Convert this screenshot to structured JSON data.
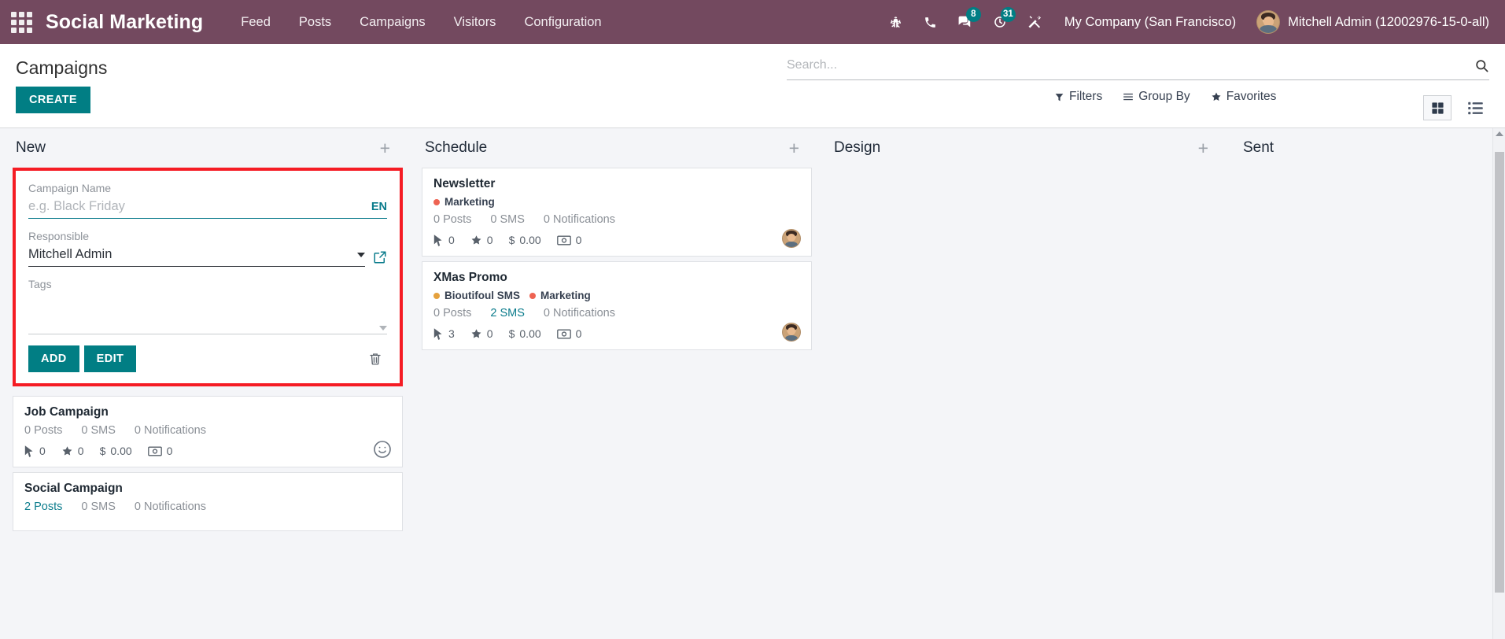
{
  "navbar": {
    "apps_icon": "apps-grid-icon",
    "brand": "Social Marketing",
    "menu": [
      {
        "label": "Feed"
      },
      {
        "label": "Posts"
      },
      {
        "label": "Campaigns"
      },
      {
        "label": "Visitors"
      },
      {
        "label": "Configuration"
      }
    ],
    "sysicons": [
      {
        "name": "bug-icon",
        "badge": null
      },
      {
        "name": "phone-icon",
        "badge": null
      },
      {
        "name": "messages-icon",
        "badge": "8"
      },
      {
        "name": "activities-clock-icon",
        "badge": "31"
      },
      {
        "name": "tools-wrench-icon",
        "badge": null
      }
    ],
    "company": "My Company (San Francisco)",
    "user": "Mitchell Admin (12002976-15-0-all)",
    "background_color": "#73495f",
    "badge_color": "#017e84"
  },
  "control_panel": {
    "title": "Campaigns",
    "create_label": "CREATE",
    "accent_color": "#017e84",
    "search": {
      "placeholder": "Search...",
      "value": "",
      "icon": "search-icon"
    },
    "filters": [
      {
        "label": "Filters",
        "icon": "filter-funnel-icon"
      },
      {
        "label": "Group By",
        "icon": "group-by-lines-icon"
      },
      {
        "label": "Favorites",
        "icon": "star-icon"
      }
    ],
    "views": [
      {
        "name": "kanban-view",
        "icon": "kanban-grid-icon",
        "active": true
      },
      {
        "name": "list-view",
        "icon": "list-icon",
        "active": false
      }
    ]
  },
  "kanban": {
    "add_icon": "plus-icon",
    "columns": [
      {
        "title": "New",
        "quick_create": {
          "highlighted": true,
          "highlight_color": "#f51c24",
          "name_label": "Campaign Name",
          "name_placeholder": "e.g. Black Friday",
          "name_value": "",
          "lang_badge": "EN",
          "responsible_label": "Responsible",
          "responsible_value": "Mitchell Admin",
          "tags_label": "Tags",
          "tags_value": "",
          "add_label": "ADD",
          "edit_label": "EDIT",
          "trash_icon": "trash-icon",
          "external_link_icon": "external-link-icon",
          "dropdown_icon": "chevron-down-icon"
        },
        "cards": [
          {
            "title": "Job Campaign",
            "tags": [],
            "counts": [
              {
                "label": "0 Posts",
                "link": false
              },
              {
                "label": "0 SMS",
                "link": false
              },
              {
                "label": "0 Notifications",
                "link": false
              }
            ],
            "stats": [
              {
                "icon": "cursor-click-icon",
                "value": "0"
              },
              {
                "icon": "star-icon",
                "value": "0"
              },
              {
                "icon": "dollar-icon",
                "value": "0.00"
              },
              {
                "icon": "banknote-icon",
                "value": "0"
              }
            ],
            "avatar": "smiley-icon"
          },
          {
            "title": "Social Campaign",
            "tags": [],
            "counts": [
              {
                "label": "2 Posts",
                "link": true
              },
              {
                "label": "0 SMS",
                "link": false
              },
              {
                "label": "0 Notifications",
                "link": false
              }
            ],
            "stats": [],
            "avatar": null
          }
        ]
      },
      {
        "title": "Schedule",
        "quick_create": null,
        "cards": [
          {
            "title": "Newsletter",
            "tags": [
              {
                "label": "Marketing",
                "color": "#ee6352"
              }
            ],
            "counts": [
              {
                "label": "0 Posts",
                "link": false
              },
              {
                "label": "0 SMS",
                "link": false
              },
              {
                "label": "0 Notifications",
                "link": false
              }
            ],
            "stats": [
              {
                "icon": "cursor-click-icon",
                "value": "0"
              },
              {
                "icon": "star-icon",
                "value": "0"
              },
              {
                "icon": "dollar-icon",
                "value": "0.00"
              },
              {
                "icon": "banknote-icon",
                "value": "0"
              }
            ],
            "avatar": "user-avatar"
          },
          {
            "title": "XMas Promo",
            "tags": [
              {
                "label": "Bioutifoul SMS",
                "color": "#e5a13d"
              },
              {
                "label": "Marketing",
                "color": "#ee6352"
              }
            ],
            "counts": [
              {
                "label": "0 Posts",
                "link": false
              },
              {
                "label": "2 SMS",
                "link": true
              },
              {
                "label": "0 Notifications",
                "link": false
              }
            ],
            "stats": [
              {
                "icon": "cursor-click-icon",
                "value": "3"
              },
              {
                "icon": "star-icon",
                "value": "0"
              },
              {
                "icon": "dollar-icon",
                "value": "0.00"
              },
              {
                "icon": "banknote-icon",
                "value": "0"
              }
            ],
            "avatar": "user-avatar"
          }
        ]
      },
      {
        "title": "Design",
        "quick_create": null,
        "cards": []
      },
      {
        "title": "Sent",
        "quick_create": null,
        "cards": []
      }
    ]
  }
}
